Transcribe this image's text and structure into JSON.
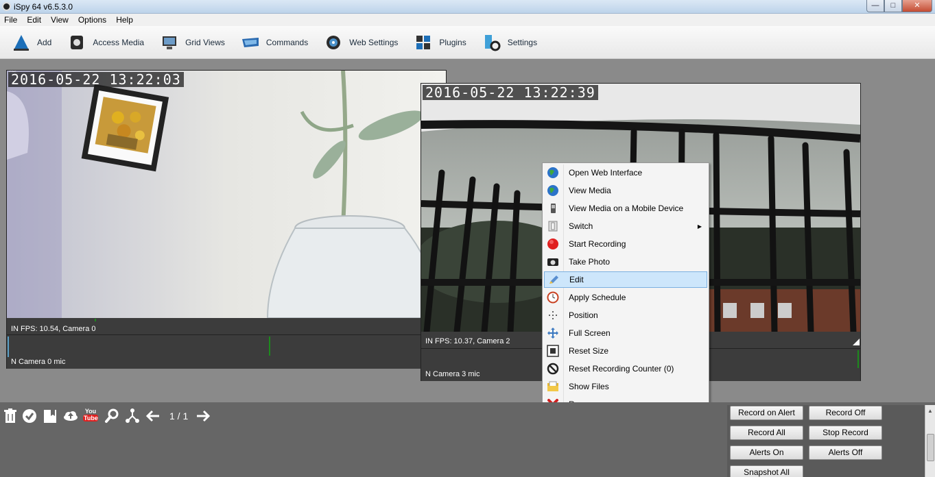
{
  "window": {
    "title": "iSpy 64 v6.5.3.0",
    "controls": [
      "—",
      "□",
      "✕"
    ]
  },
  "menu": [
    "File",
    "Edit",
    "View",
    "Options",
    "Help"
  ],
  "toolbar": [
    {
      "label": "Add",
      "icon": "add-icon"
    },
    {
      "label": "Access Media",
      "icon": "media-icon"
    },
    {
      "label": "Grid Views",
      "icon": "grid-views-icon"
    },
    {
      "label": "Commands",
      "icon": "commands-icon"
    },
    {
      "label": "Web Settings",
      "icon": "web-settings-icon"
    },
    {
      "label": "Plugins",
      "icon": "plugins-icon"
    },
    {
      "label": "Settings",
      "icon": "settings-icon"
    }
  ],
  "camera0": {
    "timestamp": "2016-05-22  13:22:03",
    "status": "IN  FPS: 10.54, Camera 0",
    "mic": "N  Camera 0 mic"
  },
  "camera2": {
    "timestamp": "2016-05-22  13:22:39",
    "status": "IN  FPS: 10.37, Camera 2",
    "mic": "N  Camera 3 mic"
  },
  "context_menu": [
    {
      "label": "Open Web Interface",
      "icon": "globe-icon"
    },
    {
      "label": "View Media",
      "icon": "globe-media-icon"
    },
    {
      "label": "View Media on a Mobile Device",
      "icon": "mobile-icon"
    },
    {
      "label": "Switch",
      "icon": "switch-icon",
      "submenu": true
    },
    {
      "label": "Start Recording",
      "icon": "record-icon"
    },
    {
      "label": "Take Photo",
      "icon": "camera-icon"
    },
    {
      "label": "Edit",
      "icon": "edit-icon",
      "highlighted": true
    },
    {
      "label": "Apply Schedule",
      "icon": "clock-icon"
    },
    {
      "label": "Position",
      "icon": "position-icon"
    },
    {
      "label": "Full Screen",
      "icon": "fullscreen-icon"
    },
    {
      "label": "Reset Size",
      "icon": "reset-size-icon"
    },
    {
      "label": "Reset Recording Counter (0)",
      "icon": "no-icon"
    },
    {
      "label": "Show Files",
      "icon": "folder-icon"
    },
    {
      "label": "Remove",
      "icon": "remove-icon"
    }
  ],
  "bottom_bar": {
    "icons": [
      "trash-icon",
      "check-icon",
      "bookmark-icon",
      "cloud-upload-icon",
      "youtube-icon",
      "search-icon",
      "share-icon",
      "arrow-left-icon",
      "arrow-right-icon"
    ],
    "youtube_text": "You\nTube",
    "pager": "1 / 1"
  },
  "buttons": [
    "Record on Alert",
    "Record Off",
    "Record All",
    "Stop Record",
    "Alerts On",
    "Alerts Off",
    "Snapshot All"
  ],
  "colors": {
    "highlight": "#cde6fb",
    "record": "#e02020",
    "remove": "#d12020",
    "tick": "#1d8a1d"
  }
}
